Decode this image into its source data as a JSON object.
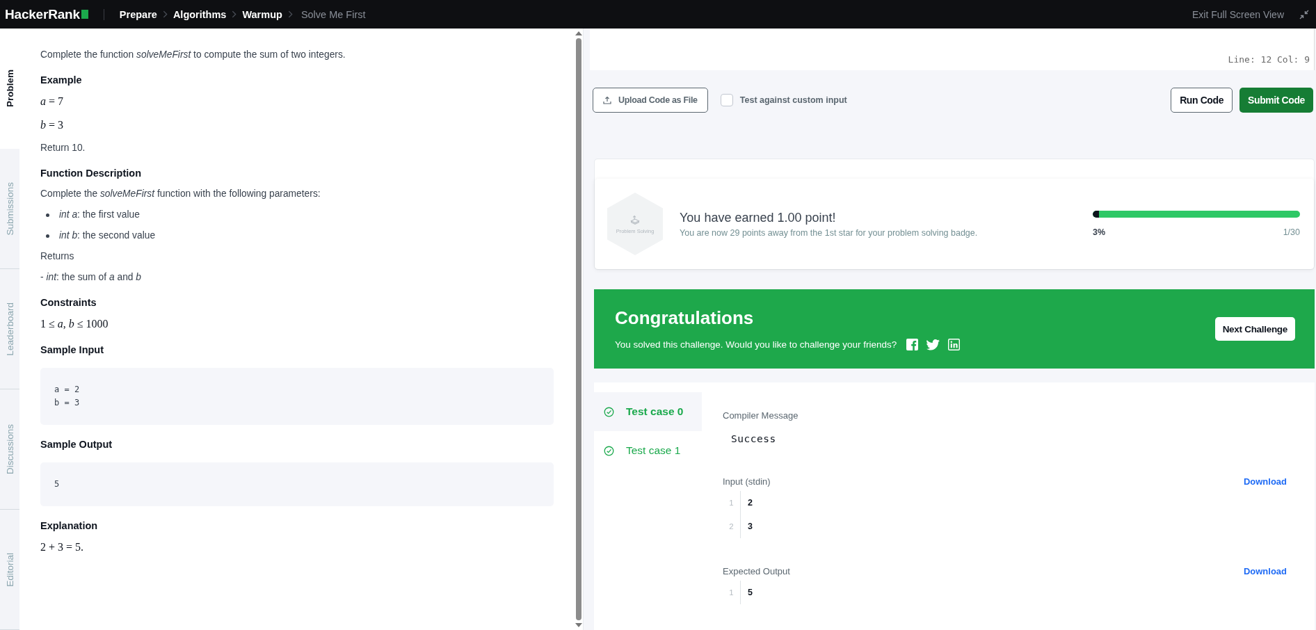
{
  "topbar": {
    "logo": "HackerRank",
    "breadcrumbs": [
      {
        "label": "Prepare",
        "current": false
      },
      {
        "label": "Algorithms",
        "current": false
      },
      {
        "label": "Warmup",
        "current": false
      },
      {
        "label": "Solve Me First",
        "current": true
      }
    ],
    "exit": "Exit Full Screen View"
  },
  "side_tabs": [
    {
      "label": "Problem",
      "selected": true
    },
    {
      "label": "Submissions",
      "selected": false
    },
    {
      "label": "Leaderboard",
      "selected": false
    },
    {
      "label": "Discussions",
      "selected": false
    },
    {
      "label": "Editorial",
      "selected": false
    }
  ],
  "problem": [
    {
      "kind": "para",
      "text": "Complete the function *solveMeFirst* to compute the sum of two integers."
    },
    {
      "kind": "heading",
      "text": "Example"
    },
    {
      "kind": "math",
      "text": "*a* = 7"
    },
    {
      "kind": "math",
      "text": "*b* = 3"
    },
    {
      "kind": "para",
      "text": "Return 10."
    },
    {
      "kind": "heading",
      "text": "Function Description"
    },
    {
      "kind": "para",
      "text": "Complete the *solveMeFirst* function with the following parameters:"
    },
    {
      "kind": "bullets",
      "items": [
        "*int a*: the first value",
        "*int b*: the second value"
      ]
    },
    {
      "kind": "para",
      "text": "Returns"
    },
    {
      "kind": "para",
      "text": "- *int*: the sum of *a* and *b*"
    },
    {
      "kind": "heading",
      "text": "Constraints"
    },
    {
      "kind": "math",
      "text": "1 ≤ *a*, *b* ≤ 1000"
    },
    {
      "kind": "heading",
      "text": "Sample Input"
    },
    {
      "kind": "code",
      "lines": [
        "a = 2",
        "b = 3"
      ]
    },
    {
      "kind": "heading",
      "text": "Sample Output"
    },
    {
      "kind": "code",
      "lines": [
        "5"
      ]
    },
    {
      "kind": "heading",
      "text": "Explanation"
    },
    {
      "kind": "math",
      "text": "2 + 3 = 5."
    }
  ],
  "editor": {
    "status": "Line: 12 Col: 9"
  },
  "actions": {
    "upload": "Upload Code as File",
    "custom_input": {
      "label": "Test against custom input",
      "checked": false
    },
    "run": "Run Code",
    "submit": "Submit Code"
  },
  "earned": {
    "badge": "Problem Solving",
    "title": "You have earned 1.00 point!",
    "subtitle": "You are now 29 points away from the 1st star for your problem solving badge.",
    "level": 0.03,
    "percent": "3%",
    "count": "1/30"
  },
  "congrats": {
    "title": "Congratulations",
    "message": "You solved this challenge. Would you like to challenge your friends?",
    "next": "Next Challenge"
  },
  "test_cases": [
    {
      "label": "Test case 0",
      "selected": true,
      "passed": true
    },
    {
      "label": "Test case 1",
      "selected": false,
      "passed": true
    }
  ],
  "result": {
    "compiler_label": "Compiler Message",
    "compiler_message": "Success",
    "sections": [
      {
        "label": "Input (stdin)",
        "download": "Download",
        "lines": [
          {
            "no": "1",
            "text": "2"
          },
          {
            "no": "2",
            "text": "3"
          }
        ]
      },
      {
        "label": "Expected Output",
        "download": "Download",
        "lines": [
          {
            "no": "1",
            "text": "5"
          }
        ]
      }
    ]
  }
}
